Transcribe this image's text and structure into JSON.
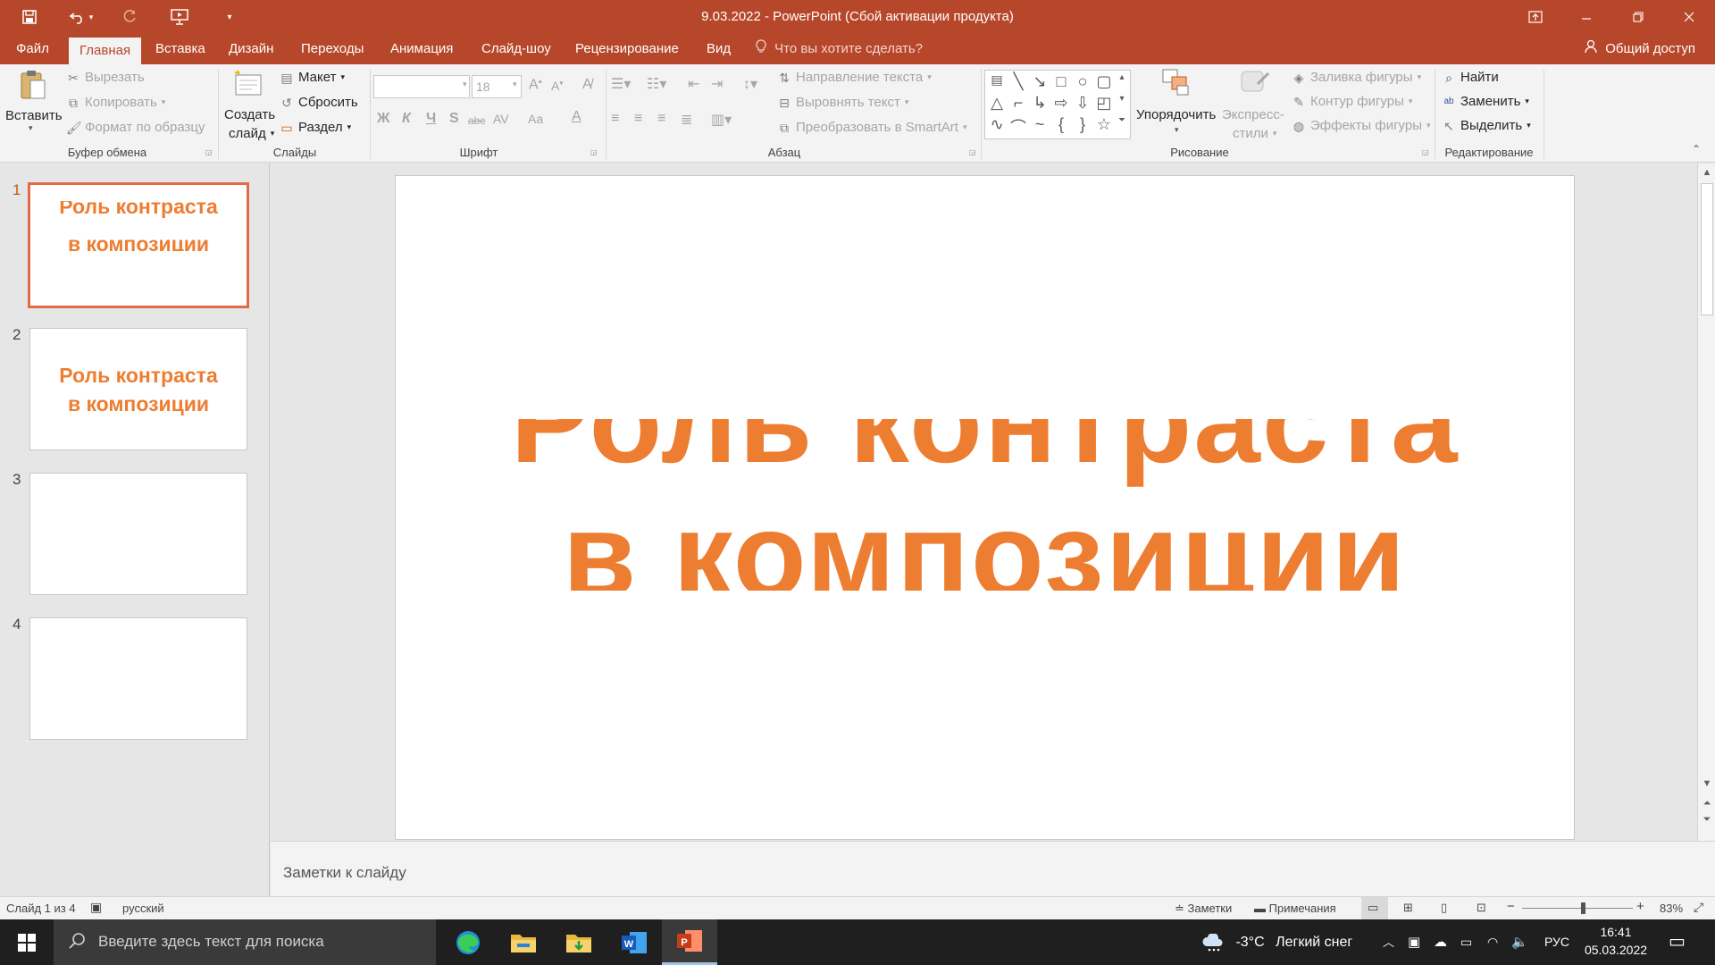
{
  "window": {
    "title": "9.03.2022 - PowerPoint (Сбой активации продукта)"
  },
  "tabs": {
    "items": [
      "Файл",
      "Главная",
      "Вставка",
      "Дизайн",
      "Переходы",
      "Анимация",
      "Слайд-шоу",
      "Рецензирование",
      "Вид"
    ],
    "active": "Главная",
    "tell_me": "Что вы хотите сделать?",
    "share": "Общий доступ"
  },
  "ribbon": {
    "clipboard": {
      "label": "Буфер обмена",
      "paste": "Вставить",
      "cut": "Вырезать",
      "copy": "Копировать",
      "format_painter": "Формат по образцу"
    },
    "slides": {
      "label": "Слайды",
      "new_slide_1": "Создать",
      "new_slide_2": "слайд",
      "layout": "Макет",
      "reset": "Сбросить",
      "section": "Раздел"
    },
    "font": {
      "label": "Шрифт",
      "font_size": "18",
      "bold": "Ж",
      "italic": "К",
      "underline": "Ч",
      "shadow": "S",
      "strike": "abc",
      "spacing": "AV",
      "case": "Aa",
      "color": "A"
    },
    "paragraph": {
      "label": "Абзац",
      "text_direction": "Направление текста",
      "align_text": "Выровнять текст",
      "smartart": "Преобразовать в SmartArt"
    },
    "drawing": {
      "label": "Рисование",
      "arrange": "Упорядочить",
      "quick_styles_1": "Экспресс-",
      "quick_styles_2": "стили",
      "shape_fill": "Заливка фигуры",
      "shape_outline": "Контур фигуры",
      "shape_effects": "Эффекты фигуры"
    },
    "editing": {
      "label": "Редактирование",
      "find": "Найти",
      "replace": "Заменить",
      "select": "Выделить"
    }
  },
  "slides": [
    {
      "number": "1",
      "title_line1": "Роль контраста",
      "title_line2": "в композиции"
    },
    {
      "number": "2",
      "title_line1": "Роль контраста",
      "title_line2": "в композиции"
    },
    {
      "number": "3"
    },
    {
      "number": "4"
    }
  ],
  "current_slide": {
    "title_line1": "Роль контраста",
    "title_line2": "в композиции"
  },
  "notes_placeholder": "Заметки к слайду",
  "status": {
    "slide_counter": "Слайд 1 из 4",
    "language": "русский",
    "notes": "Заметки",
    "comments": "Примечания",
    "zoom": "83%",
    "zoom_fraction": 0.55
  },
  "taskbar": {
    "search_placeholder": "Введите здесь текст для поиска",
    "weather_temp": "-3°C",
    "weather_text": "Легкий снег",
    "input_lang": "РУС",
    "time": "16:41",
    "date": "05.03.2022"
  },
  "colors": {
    "accent": "#b7472a",
    "title_orange": "#ed7d31"
  }
}
